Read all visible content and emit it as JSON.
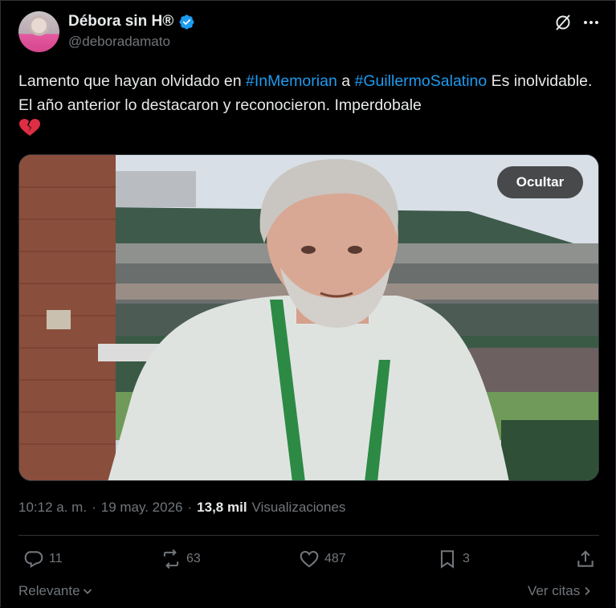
{
  "post": {
    "author_name": "Débora sin H®",
    "handle": "@deboradamato",
    "text_part1": "Lamento que hayan olvidado en ",
    "hashtag1": "#InMemorian",
    "text_part2": " a ",
    "hashtag2": "#GuillermoSalatino",
    "text_part3": " Es inolvidable. El año anterior lo destacaron y reconocieron. Imperdobale ",
    "emoji_icon": "broken-heart-icon",
    "media_hide_label": "Ocultar",
    "time": "10:12 a. m.",
    "separator": "·",
    "date": "19 may. 2026",
    "views_count": "13,8 mil",
    "views_label": "Visualizaciones"
  },
  "actions": {
    "replies": "11",
    "reposts": "63",
    "likes": "487",
    "bookmarks": "3"
  },
  "footer": {
    "sort_label": "Relevante",
    "quotes_label": "Ver citas"
  },
  "colors": {
    "background": "#000000",
    "accent": "#1d9bf0",
    "text": "#e7e9ea",
    "muted": "#71767b"
  }
}
